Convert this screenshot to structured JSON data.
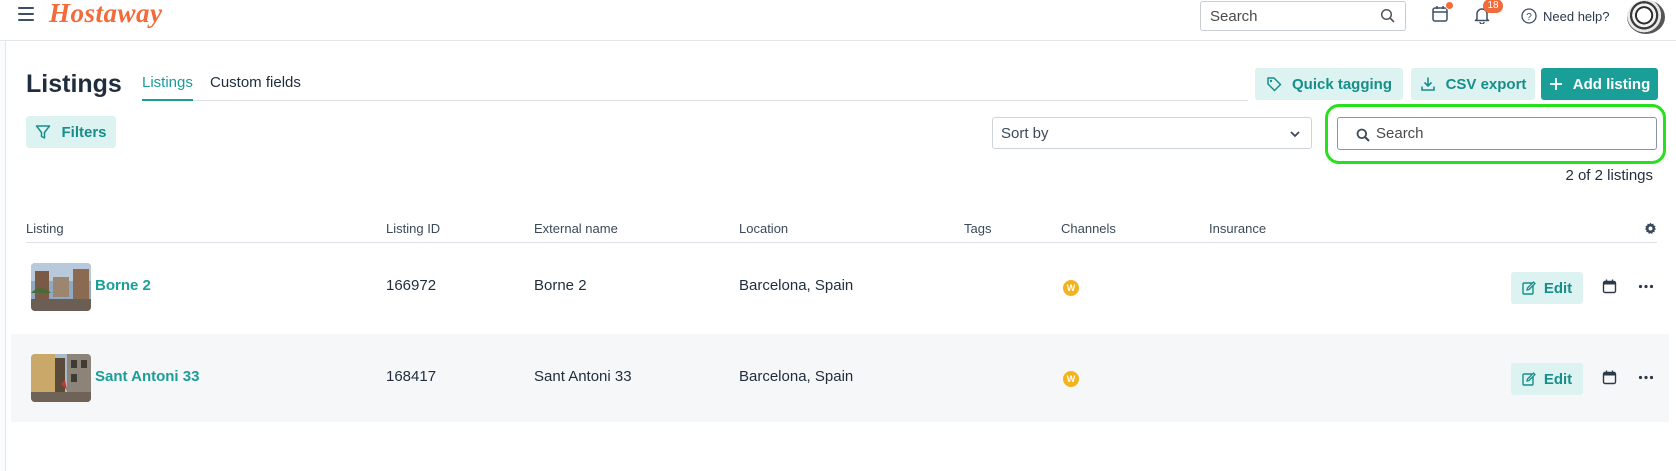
{
  "app": {
    "logo_text": "Hostaway",
    "search_placeholder": "Search",
    "notifications_count": "18",
    "help_label": "Need help?"
  },
  "page": {
    "title": "Listings",
    "tabs": [
      {
        "label": "Listings",
        "active": true
      },
      {
        "label": "Custom fields",
        "active": false
      }
    ],
    "actions": {
      "quick_tagging": "Quick tagging",
      "csv_export": "CSV export",
      "add_listing": "Add listing"
    }
  },
  "toolbar": {
    "filters_label": "Filters",
    "sort_placeholder": "Sort by",
    "search_placeholder": "Search",
    "count_text": "2 of 2 listings"
  },
  "table": {
    "columns": [
      "Listing",
      "Listing ID",
      "External name",
      "Location",
      "Tags",
      "Channels",
      "Insurance"
    ],
    "rows": [
      {
        "name": "Borne 2",
        "id": "166972",
        "external_name": "Borne 2",
        "location": "Barcelona, Spain",
        "tags": "",
        "channel_badge": "W",
        "insurance": "",
        "edit_label": "Edit"
      },
      {
        "name": "Sant Antoni 33",
        "id": "168417",
        "external_name": "Sant Antoni 33",
        "location": "Barcelona, Spain",
        "tags": "",
        "channel_badge": "W",
        "insurance": "",
        "edit_label": "Edit"
      }
    ]
  },
  "colors": {
    "accent": "#1a9e98",
    "brand": "#f26b3a",
    "channel_badge": "#f2b31c",
    "highlight_ring": "#27e01c"
  }
}
